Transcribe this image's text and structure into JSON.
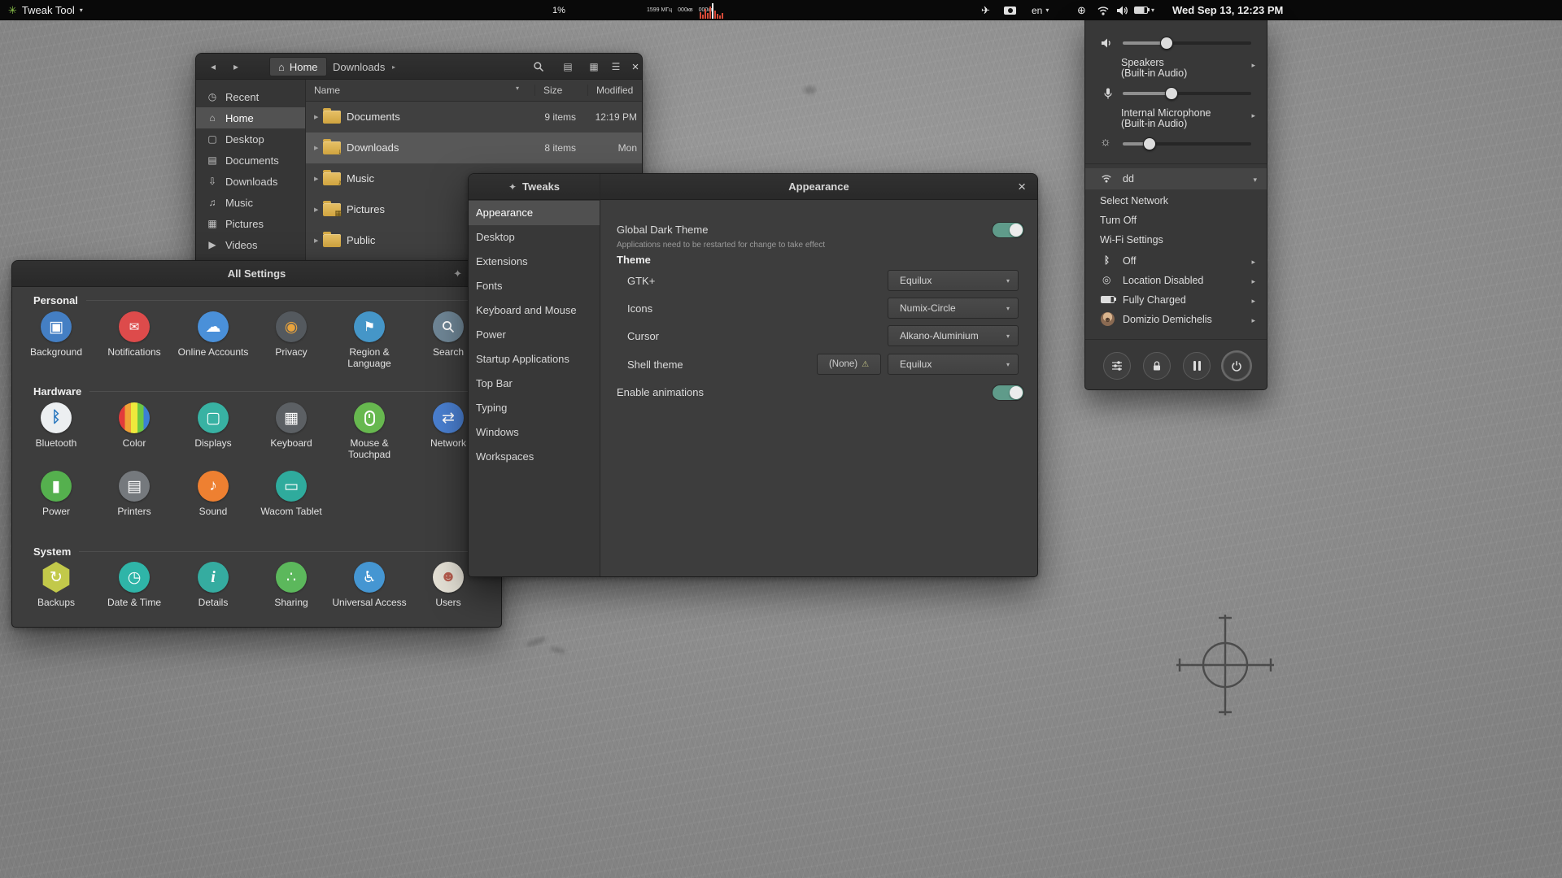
{
  "icons": {
    "caret_down": "▾",
    "submenu_right": "▸",
    "expander_right": "▶",
    "close_x": "×",
    "back": "◂",
    "forward": "▸",
    "hamburger": "☰",
    "list_view": "▤",
    "grid_view": "▦",
    "home": "⌂",
    "app_logo": "✳",
    "compass": "✦",
    "globe": "⊕",
    "plane": "✈",
    "brightness": "☼",
    "warning": "⚠",
    "location": "◎",
    "bluetooth": "ᛒ",
    "person": "☻"
  },
  "topbar": {
    "app_menu_label": "Tweak Tool",
    "cpu": "1%",
    "cpu_freq": "1599 МГц",
    "net_up": "000кв",
    "net_down": "000кв",
    "keyboard_layout": "en",
    "clock": "Wed Sep 13, 12:23 PM"
  },
  "files_window": {
    "home_crumb": "Home",
    "downloads_crumb": "Downloads",
    "columns": {
      "name": "Name",
      "size": "Size",
      "modified": "Modified"
    },
    "sidebar": [
      {
        "label": "Recent",
        "glyph": "◷"
      },
      {
        "label": "Home",
        "glyph": "⌂"
      },
      {
        "label": "Desktop",
        "glyph": "▢"
      },
      {
        "label": "Documents",
        "glyph": "▤"
      },
      {
        "label": "Downloads",
        "glyph": "⇩"
      },
      {
        "label": "Music",
        "glyph": "♫"
      },
      {
        "label": "Pictures",
        "glyph": "▦"
      },
      {
        "label": "Videos",
        "glyph": "▶"
      }
    ],
    "rows": [
      {
        "name": "Documents",
        "emblem": "",
        "size": "9 items",
        "modified": "12:19 PM"
      },
      {
        "name": "Downloads",
        "emblem": "↓",
        "size": "8 items",
        "modified": "Mon"
      },
      {
        "name": "Music",
        "emblem": "♪",
        "size": "",
        "modified": ""
      },
      {
        "name": "Pictures",
        "emblem": "▦",
        "size": "",
        "modified": ""
      },
      {
        "name": "Public",
        "emblem": "",
        "size": "",
        "modified": ""
      }
    ]
  },
  "settings_window": {
    "title": "All Settings",
    "sections": {
      "personal": {
        "label": "Personal",
        "items": [
          {
            "label": "Background",
            "color": "#447fc4",
            "glyph": "▣"
          },
          {
            "label": "Notifications",
            "color": "#dd4b4b",
            "glyph": "✉"
          },
          {
            "label": "Online Accounts",
            "color": "#4a90d9",
            "glyph": "☁"
          },
          {
            "label": "Privacy",
            "color": "#54595e",
            "glyph": "◉"
          },
          {
            "label": "Region & Language",
            "color": "#4596c8",
            "glyph": "⚑"
          },
          {
            "label": "Search",
            "color": "#6f8696",
            "glyph": ""
          }
        ]
      },
      "hardware": {
        "label": "Hardware",
        "items": [
          {
            "label": "Bluetooth",
            "color": "#eceff1",
            "glyph": "ᛒ"
          },
          {
            "label": "Color",
            "color": "",
            "glyph": ""
          },
          {
            "label": "Displays",
            "color": "#38b2a3",
            "glyph": "▢"
          },
          {
            "label": "Keyboard",
            "color": "#5c6064",
            "glyph": "▦"
          },
          {
            "label": "Mouse & Touchpad",
            "color": "#67b84f",
            "glyph": ""
          },
          {
            "label": "Network",
            "color": "#4a7fd0",
            "glyph": "⇄"
          },
          {
            "label": "Power",
            "color": "#55b04e",
            "glyph": "▮"
          },
          {
            "label": "Printers",
            "color": "#75797d",
            "glyph": "▤"
          },
          {
            "label": "Sound",
            "color": "#ee8031",
            "glyph": "♪"
          },
          {
            "label": "Wacom Tablet",
            "color": "#2fab9d",
            "glyph": "▭"
          }
        ]
      },
      "system": {
        "label": "System",
        "items": [
          {
            "label": "Backups",
            "color": "#c2c94a",
            "glyph": "↻"
          },
          {
            "label": "Date & Time",
            "color": "#2fb5a8",
            "glyph": "◷"
          },
          {
            "label": "Details",
            "color": "#35aca0",
            "glyph": "i"
          },
          {
            "label": "Sharing",
            "color": "#5cb85c",
            "glyph": "∴"
          },
          {
            "label": "Universal Access",
            "color": "#4596d2",
            "glyph": "♿"
          },
          {
            "label": "Users",
            "color": "#e4e0d5",
            "glyph": "☻"
          }
        ]
      }
    }
  },
  "tweaks_window": {
    "sidebar_title": "Tweaks",
    "panel_title": "Appearance",
    "nav": [
      "Appearance",
      "Desktop",
      "Extensions",
      "Fonts",
      "Keyboard and Mouse",
      "Power",
      "Startup Applications",
      "Top Bar",
      "Typing",
      "Windows",
      "Workspaces"
    ],
    "dark_theme_label": "Global Dark Theme",
    "dark_theme_on": true,
    "restart_note": "Applications need to be restarted for change to take effect",
    "theme_heading": "Theme",
    "rows": [
      {
        "label": "GTK+",
        "value": "Equilux"
      },
      {
        "label": "Icons",
        "value": "Numix-Circle"
      },
      {
        "label": "Cursor",
        "value": "Alkano-Aluminium"
      },
      {
        "label": "Shell theme",
        "none_label": "(None)",
        "value": "Equilux"
      }
    ],
    "animations_label": "Enable animations",
    "animations_on": true
  },
  "system_menu": {
    "speakers_title": "Speakers",
    "speakers_subtitle": "(Built-in Audio)",
    "mic_title": "Internal Microphone",
    "mic_subtitle": "(Built-in Audio)",
    "volume_fill": "34%",
    "mic_fill": "38%",
    "brightness_fill": "21%",
    "wifi_name": "dd",
    "select_network_label": "Select Network",
    "turn_off_label": "Turn Off",
    "wifi_settings_label": "Wi-Fi Settings",
    "bluetooth_status": "Off",
    "location_status": "Location Disabled",
    "battery_status": "Fully Charged",
    "user_name": "Domizio Demichelis"
  }
}
